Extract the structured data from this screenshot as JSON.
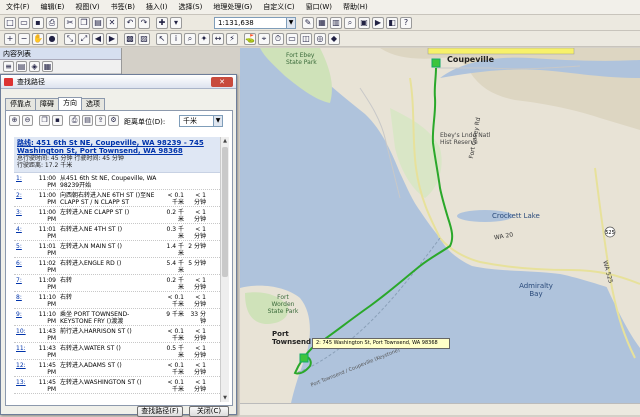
{
  "menu": [
    "文件(F)",
    "编辑(E)",
    "视图(V)",
    "书签(B)",
    "插入(I)",
    "选择(S)",
    "地理处理(G)",
    "自定义(C)",
    "窗口(W)",
    "帮助(H)"
  ],
  "toolbar": {
    "scale": "1:131,638"
  },
  "toc": {
    "title": "内容列表"
  },
  "dialog": {
    "title": "查找路径",
    "tabs": [
      "停靠点",
      "障碍",
      "方向",
      "选项"
    ],
    "units_label": "距离单位(D):",
    "units_value": "千米",
    "route_link": "路线: 451 6th St NE, Coupeville, WA 98239 - 745 Washington St, Port Townsend, WA 98368",
    "total_time": "总行驶时间: 45 分钟  行驶时间: 45 分钟",
    "total_dist": "行驶距离: 17.2 千米",
    "steps": [
      {
        "num": "1:",
        "time": "11:00 PM",
        "text": "从451 6th St NE, Coupeville, WA 98239开始",
        "dist": "",
        "dur": ""
      },
      {
        "num": "2:",
        "time": "11:00 PM",
        "text": "向西朝右转进入NE 6TH ST ()至NE CLAPP ST / N CLAPP ST",
        "dist": "< 0.1 千米",
        "dur": "< 1 分钟"
      },
      {
        "num": "3:",
        "time": "11:00 PM",
        "text": "左转进入NE CLAPP ST ()",
        "dist": "0.2 千米",
        "dur": "< 1 分钟"
      },
      {
        "num": "4:",
        "time": "11:01 PM",
        "text": "右转进入NE 4TH ST ()",
        "dist": "0.3 千米",
        "dur": "< 1 分钟"
      },
      {
        "num": "5:",
        "time": "11:01 PM",
        "text": "左转进入N MAIN ST ()",
        "dist": "1.4 千米",
        "dur": "2 分钟"
      },
      {
        "num": "6:",
        "time": "11:02 PM",
        "text": "右转进入ENGLE RD ()",
        "dist": "5.4 千米",
        "dur": "5 分钟"
      },
      {
        "num": "7:",
        "time": "11:09 PM",
        "text": "右转",
        "dist": "0.2 千米",
        "dur": "< 1 分钟"
      },
      {
        "num": "8:",
        "time": "11:10 PM",
        "text": "右转",
        "dist": "< 0.1 千米",
        "dur": "< 1 分钟"
      },
      {
        "num": "9:",
        "time": "11:10 PM",
        "text": "乘坐 PORT TOWNSEND-KEYSTONE FRY ()渡渡",
        "dist": "9 千米",
        "dur": "33 分钟"
      },
      {
        "num": "10:",
        "time": "11:43 PM",
        "text": "前行进入HARRISON ST ()",
        "dist": "< 0.1 千米",
        "dur": "< 1 分钟"
      },
      {
        "num": "11:",
        "time": "11:43 PM",
        "text": "右转进入WATER ST ()",
        "dist": "0.5 千米",
        "dur": "< 1 分钟"
      },
      {
        "num": "12:",
        "time": "11:45 PM",
        "text": "左转进入ADAMS ST ()",
        "dist": "< 0.1 千米",
        "dur": "< 1 分钟"
      },
      {
        "num": "13:",
        "time": "11:45 PM",
        "text": "左转进入WASHINGTON ST ()",
        "dist": "< 0.1 千米",
        "dur": "< 1 分钟"
      }
    ],
    "find_route": "查找路径(F)",
    "close": "关闭(C)"
  },
  "map": {
    "callout": "2: 745 Washington St, Port Townsend, WA 98368",
    "labels": {
      "coupeville": "Coupeville",
      "fort_ebey": "Fort Ebey State Park",
      "ebeys": "Ebey's Lndg Natl Hist Reserve",
      "fort_casey": "Fort Casey Rd",
      "crockett": "Crockett Lake",
      "admiralty": "Admiralty Bay",
      "fort_worden": "Fort Worden State Park",
      "port_townsend": "Port Townsend",
      "wa20": "WA 20",
      "wa525": "WA 525",
      "ferry": "Port Townsend / Coupeville (Keystone)",
      "hwy525": "525"
    },
    "colors": {
      "water": "#afc3dc",
      "land": "#e8e3d6",
      "route": "#2aa82a"
    }
  }
}
